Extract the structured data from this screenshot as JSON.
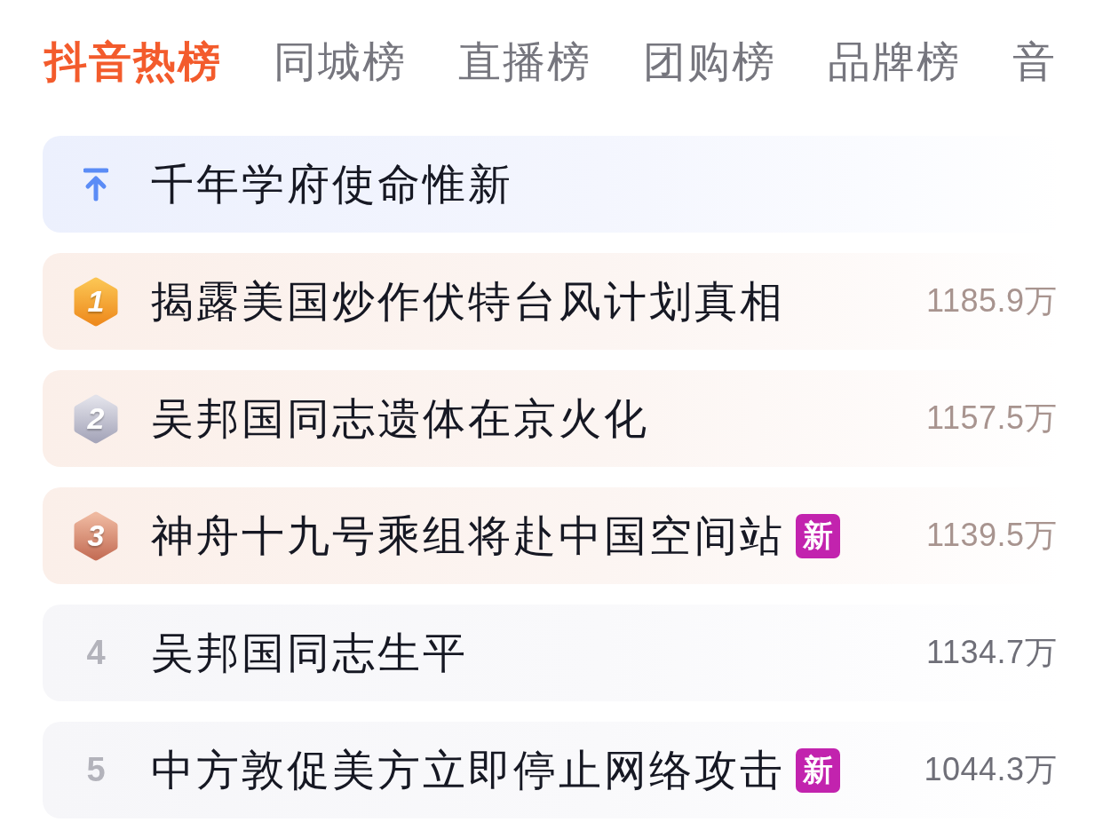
{
  "tabs": [
    {
      "label": "抖音热榜",
      "selected": true
    },
    {
      "label": "同城榜",
      "selected": false
    },
    {
      "label": "直播榜",
      "selected": false
    },
    {
      "label": "团购榜",
      "selected": false
    },
    {
      "label": "品牌榜",
      "selected": false
    },
    {
      "label": "音",
      "selected": false
    }
  ],
  "pinned": {
    "title": "千年学府使命惟新"
  },
  "rows": [
    {
      "rank": "1",
      "kind": "gold",
      "title": "揭露美国炒作伏特台风计划真相",
      "heat": "1185.9万"
    },
    {
      "rank": "2",
      "kind": "silver",
      "title": "吴邦国同志遗体在京火化",
      "heat": "1157.5万"
    },
    {
      "rank": "3",
      "kind": "bronze",
      "title": "神舟十九号乘组将赴中国空间站",
      "badge": "新",
      "heat": "1139.5万"
    },
    {
      "rank": "4",
      "kind": "plain",
      "title": "吴邦国同志生平",
      "heat": "1134.7万"
    },
    {
      "rank": "5",
      "kind": "plain",
      "title": "中方敦促美方立即停止网络攻击",
      "badge": "新",
      "heat": "1044.3万"
    }
  ]
}
